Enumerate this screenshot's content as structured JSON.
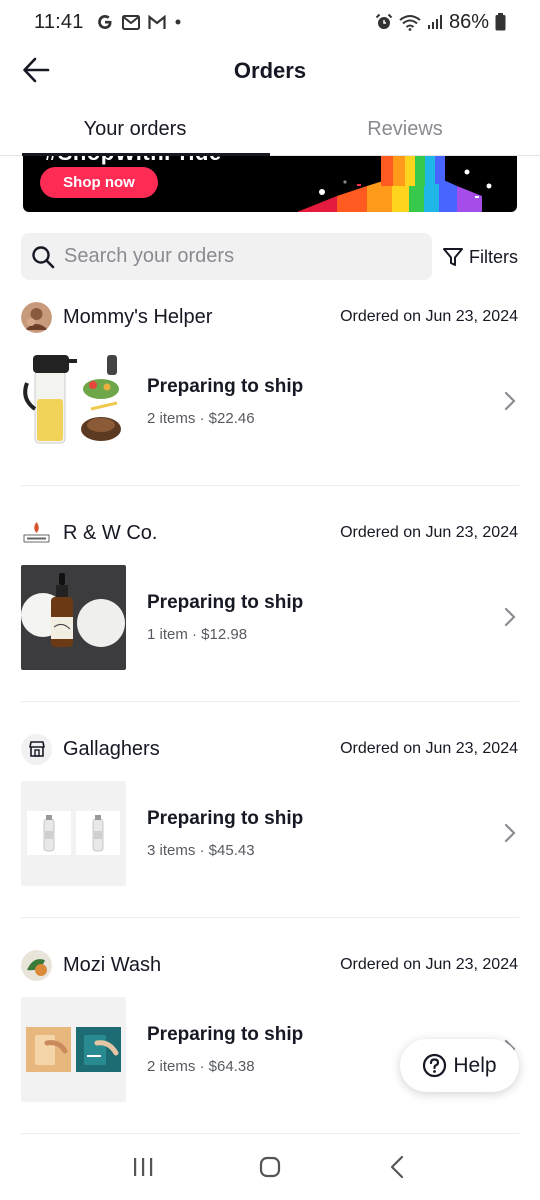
{
  "status_bar": {
    "time": "11:41",
    "battery": "86%",
    "left_icons": [
      "google-icon",
      "gmail-icon",
      "gmail-icon",
      "dot-icon"
    ],
    "right_icons": [
      "alarm-icon",
      "wifi-icon",
      "signal-icon",
      "battery-icon"
    ]
  },
  "header": {
    "title": "Orders",
    "back_icon": "arrow-left-icon"
  },
  "tabs": [
    {
      "label": "Your orders",
      "active": true
    },
    {
      "label": "Reviews",
      "active": false
    }
  ],
  "banner": {
    "partial_text": "#ShopWithPride",
    "button_label": "Shop now"
  },
  "search": {
    "placeholder": "Search your orders",
    "filters_label": "Filters"
  },
  "orders": [
    {
      "shop": "Mommy's Helper",
      "date": "Ordered on Jun 23, 2024",
      "status": "Preparing to ship",
      "summary": "2 items · $22.46"
    },
    {
      "shop": "R & W Co.",
      "date": "Ordered on Jun 23, 2024",
      "status": "Preparing to ship",
      "summary": "1 item · $12.98"
    },
    {
      "shop": "Gallaghers",
      "date": "Ordered on Jun 23, 2024",
      "status": "Preparing to ship",
      "summary": "3 items · $45.43"
    },
    {
      "shop": "Mozi Wash",
      "date": "Ordered on Jun 23, 2024",
      "status": "Preparing to ship",
      "summary": "2 items · $64.38"
    }
  ],
  "help": {
    "label": "Help"
  },
  "nav_bar": {
    "buttons": [
      "recent-apps-icon",
      "home-icon",
      "back-icon"
    ]
  },
  "colors": {
    "accent": "#fe2c55",
    "text_primary": "#161823",
    "text_secondary": "#8a8b91",
    "search_bg": "#f1f1f2"
  }
}
